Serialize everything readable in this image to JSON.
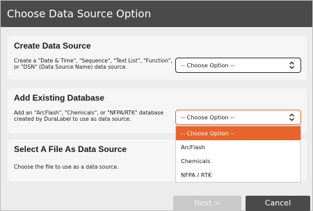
{
  "dialog": {
    "title": "Choose Data Source Option"
  },
  "sections": {
    "create": {
      "title": "Create Data Source",
      "description": "Create a \"Date & Time\", \"Sequence\", \"Text List\", \"Function\", or \"DSN\" (Data Source Name) data source.",
      "select_value": "-- Choose Option --"
    },
    "existing": {
      "title": "Add Existing Database",
      "description": "Add an \"ArcFlash\", \"Chemicals\", or \"NFPA/RTK\" database created by DuraLabel to use as data source.",
      "select_value": "-- Choose Option --"
    },
    "file": {
      "title": "Select A File As Data Source",
      "description": "Choose the file to use as a data source."
    }
  },
  "dropdown": {
    "options": [
      "-- Choose Option --",
      "ArcFlash",
      "Chemicals",
      "NFPA / RTK"
    ],
    "highlighted_index": 0
  },
  "buttons": {
    "next": "Next >",
    "cancel": "Cancel"
  },
  "colors": {
    "accent": "#e9642c",
    "titlebar": "#4a4a4a",
    "background": "#ececec"
  },
  "icons": {
    "select_chevron": "up-down-chevron-icon"
  }
}
